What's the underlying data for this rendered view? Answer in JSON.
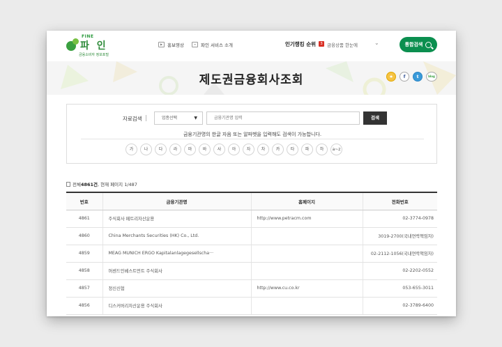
{
  "header": {
    "logo_top": "FINE",
    "logo_name": "파 인",
    "logo_sub": "금융소비자 정보포털",
    "nav": [
      {
        "label": "홍보영상",
        "icon": "play-icon"
      },
      {
        "label": "파인 서비스 소개",
        "icon": "document-icon"
      }
    ],
    "ranking": {
      "title": "인기랭킹 순위",
      "rank": "3",
      "item": "금융상품 한눈에"
    },
    "search_button": "통합검색"
  },
  "banner": {
    "title": "제도권금융회사조회",
    "share": [
      "★",
      "f",
      "t",
      "blog"
    ]
  },
  "search": {
    "label": "자료검색",
    "select_value": "업종선택",
    "input_placeholder": "금융기관명 입력",
    "button": "검색",
    "help": "금융기관명의 한글 자음 또는 알파벳을 입력해도 검색이 가능합니다.",
    "alphabet": [
      "가",
      "나",
      "다",
      "라",
      "마",
      "바",
      "사",
      "아",
      "자",
      "차",
      "카",
      "타",
      "파",
      "하",
      "a~z"
    ]
  },
  "summary": {
    "prefix": "전체",
    "total": "4861건",
    "rest": ", 현재 페이지 1/487"
  },
  "table": {
    "headers": [
      "번호",
      "금융기관명",
      "홈페이지",
      "전화번호"
    ],
    "rows": [
      [
        "4861",
        "주식회사 페트리자산운용",
        "http://www.petracm.com",
        "02-3774-0978"
      ],
      [
        "4860",
        "China Merchants Securities (HK) Co., Ltd.",
        "",
        "3019-2700(국내연락책임자)"
      ],
      [
        "4859",
        "MEAG MUNICH ERGO Kapitalanlagegesellscha···",
        "",
        "02-2112-1056(국내연락책임자)"
      ],
      [
        "4858",
        "머센드인베스트먼트 주식회사",
        "",
        "02-2202-0552"
      ],
      [
        "4857",
        "정신신협",
        "http://www.cu.co.kr",
        "053-655-3011"
      ],
      [
        "4856",
        "디스커버리자산운용 주식회사",
        "",
        "02-3789-6400"
      ]
    ]
  },
  "colors": {
    "brand_green": "#0b8f4f",
    "rank_red": "#d93025",
    "logo_green": "#2e8b3a"
  }
}
